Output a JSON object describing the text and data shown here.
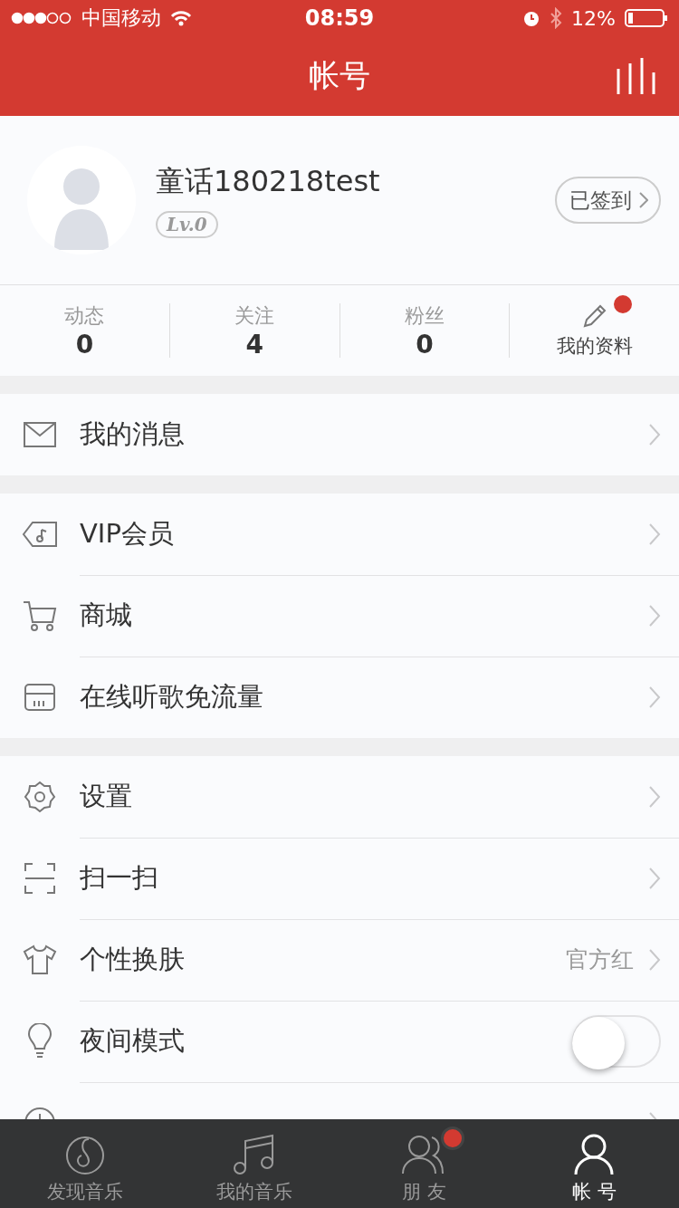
{
  "status_bar": {
    "carrier": "中国移动",
    "time": "08:59",
    "battery": "12%"
  },
  "nav": {
    "title": "帐号"
  },
  "profile": {
    "name": "童话180218test",
    "level": "Lv.0",
    "checkin": "已签到"
  },
  "stats": [
    {
      "label": "动态",
      "count": "0"
    },
    {
      "label": "关注",
      "count": "4"
    },
    {
      "label": "粉丝",
      "count": "0"
    }
  ],
  "profile_link": {
    "label": "我的资料",
    "badge": true
  },
  "groups": [
    {
      "rows": [
        {
          "kind": "link",
          "label": "我的消息"
        }
      ]
    },
    {
      "rows": [
        {
          "kind": "link",
          "label": "VIP会员"
        },
        {
          "kind": "link",
          "label": "商城"
        },
        {
          "kind": "link",
          "label": "在线听歌免流量"
        }
      ]
    },
    {
      "rows": [
        {
          "kind": "link",
          "label": "设置"
        },
        {
          "kind": "link",
          "label": "扫一扫"
        },
        {
          "kind": "link",
          "label": "个性换肤",
          "value": "官方红"
        },
        {
          "kind": "toggle",
          "label": "夜间模式",
          "on": false
        },
        {
          "kind": "link"
        }
      ]
    }
  ],
  "tabs": [
    {
      "label": "发现音乐",
      "selected": false,
      "badge": false
    },
    {
      "label": "我的音乐",
      "selected": false,
      "badge": false
    },
    {
      "label": "朋 友",
      "selected": false,
      "badge": true
    },
    {
      "label": "帐 号",
      "selected": true,
      "badge": false
    }
  ]
}
